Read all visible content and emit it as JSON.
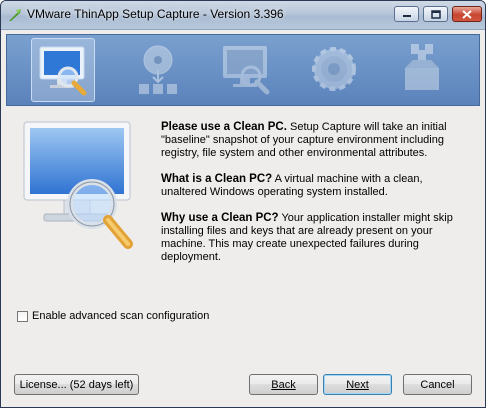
{
  "window": {
    "title": "VMware ThinApp Setup Capture - Version 3.396"
  },
  "banner": {
    "steps": [
      "clean-pc-icon",
      "install-icon",
      "capture-icon",
      "settings-icon",
      "package-icon"
    ],
    "active_step": 0
  },
  "main": {
    "p1_bold": "Please use a Clean PC.",
    "p1_text": " Setup Capture will take an initial \"baseline\" snapshot of your capture environment including registry, file system and other environmental attributes.",
    "p2_bold": "What is a Clean PC?",
    "p2_text": " A virtual machine with a clean, unaltered Windows operating system installed.",
    "p3_bold": "Why use a Clean PC?",
    "p3_text": " Your application installer might skip installing files and keys that are already present on your machine. This may create unexpected failures during deployment."
  },
  "options": {
    "advanced_scan_label": "Enable advanced scan configuration",
    "advanced_scan_checked": false
  },
  "footer": {
    "license_label": "License... (52 days left)",
    "back_label": "Back",
    "next_label": "Next",
    "cancel_label": "Cancel"
  },
  "colors": {
    "banner": "#5b83bb",
    "title_bar": "#b7c6d9",
    "default_button_border": "#3c7fb1"
  }
}
